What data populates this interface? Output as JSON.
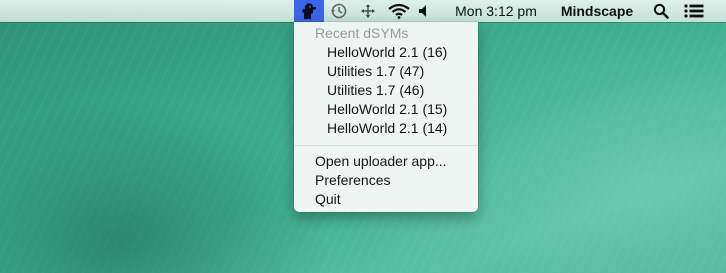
{
  "menubar": {
    "clock": "Mon 3:12 pm",
    "user": "Mindscape",
    "icons": {
      "app": "dsym-uploader-icon",
      "time_machine": "time-machine-icon",
      "move": "move-arrows-icon",
      "wifi": "wifi-icon",
      "volume": "volume-icon",
      "spotlight": "search-icon",
      "notifications": "list-icon"
    },
    "highlight_color": "#3b64e6"
  },
  "dropdown": {
    "header": "Recent dSYMs",
    "recent": [
      "HelloWorld 2.1 (16)",
      "Utilities 1.7 (47)",
      "Utilities 1.7 (46)",
      "HelloWorld 2.1 (15)",
      "HelloWorld 2.1 (14)"
    ],
    "open_uploader": "Open uploader app...",
    "preferences": "Preferences",
    "quit": "Quit"
  }
}
